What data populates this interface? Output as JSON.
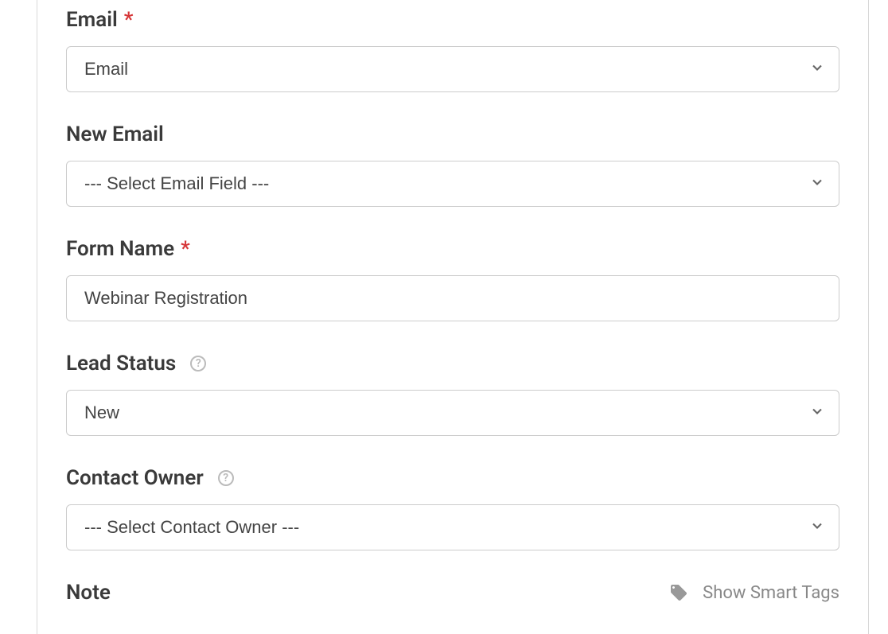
{
  "fields": {
    "email": {
      "label": "Email",
      "required": true,
      "value": "Email"
    },
    "newEmail": {
      "label": "New Email",
      "required": false,
      "value": "--- Select Email Field ---"
    },
    "formName": {
      "label": "Form Name",
      "required": true,
      "value": "Webinar Registration"
    },
    "leadStatus": {
      "label": "Lead Status",
      "required": false,
      "hasHelp": true,
      "value": "New"
    },
    "contactOwner": {
      "label": "Contact Owner",
      "required": false,
      "hasHelp": true,
      "value": "--- Select Contact Owner ---"
    },
    "note": {
      "label": "Note"
    }
  },
  "smartTags": {
    "label": "Show Smart Tags"
  },
  "requiredMarker": "*"
}
